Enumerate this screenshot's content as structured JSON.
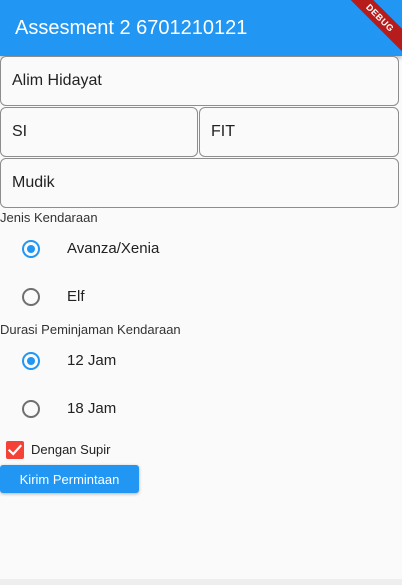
{
  "appbar": {
    "title": "Assesment 2 6701210121",
    "debug_label": "DEBUG"
  },
  "form": {
    "name_value": "Alim Hidayat",
    "major_value": "SI",
    "faculty_value": "FIT",
    "purpose_value": "Mudik"
  },
  "vehicle": {
    "label": "Jenis Kendaraan",
    "options": [
      {
        "label": "Avanza/Xenia",
        "selected": true
      },
      {
        "label": "Elf",
        "selected": false
      }
    ]
  },
  "duration": {
    "label": "Durasi Peminjaman Kendaraan",
    "options": [
      {
        "label": "12 Jam",
        "selected": true
      },
      {
        "label": "18 Jam",
        "selected": false
      }
    ]
  },
  "driver": {
    "label": "Dengan Supir",
    "checked": true
  },
  "submit_label": "Kirim Permintaan",
  "colors": {
    "primary": "#2196f3",
    "checkbox": "#f44336",
    "debug_banner": "#b71c1c"
  }
}
